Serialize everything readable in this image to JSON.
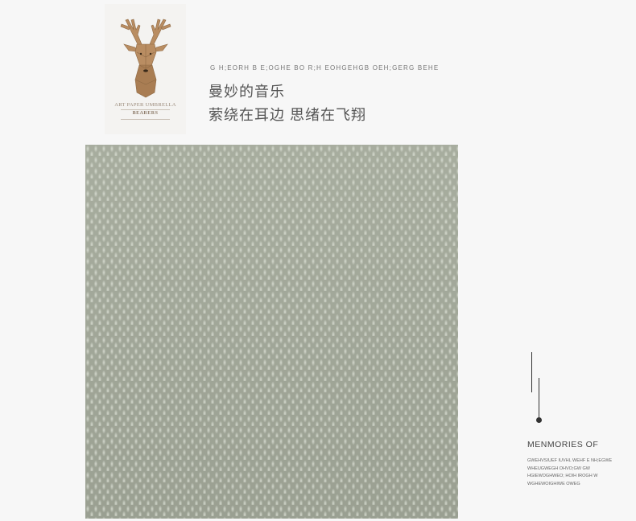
{
  "logo": {
    "icon": "deer-head-icon",
    "line1": "ART PAPER UMBRELLA",
    "line2": "BEARERS"
  },
  "header": {
    "latin_line": "G H;EORH B E;OGHE BO R;H  EOHGEHGB OEH;GERG  BEHE",
    "title_line1": "曼妙的音乐",
    "title_line2": "萦绕在耳边 思绪在飞翔"
  },
  "fabric": {
    "color": "#a4aa9b"
  },
  "side_note": {
    "title": "MENMORIES OF",
    "lines": [
      "GWEHVSIUEF IUVHL WEHF E NH;EGWE",
      "WHEUGWEGH OHVO;GW GW",
      " HGIEWOGHWEO; HOIH IROGH W",
      "WGHEWOIGHIWE OWEG"
    ]
  }
}
